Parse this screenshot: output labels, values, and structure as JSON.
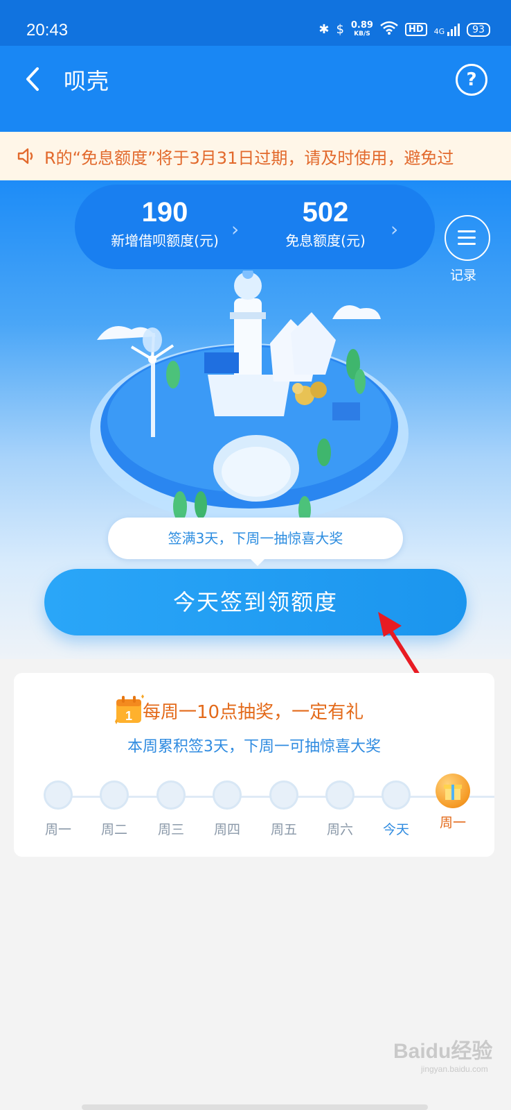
{
  "status_bar": {
    "time": "20:43",
    "network_speed": "0.89",
    "speed_unit": "KB/S",
    "hd": "HD",
    "signal": "4G",
    "battery": "93"
  },
  "app_bar": {
    "title": "呗壳"
  },
  "notice": {
    "text": "R的“免息额度”将于3月31日过期，请及时使用，避免过"
  },
  "stats": [
    {
      "value": "190",
      "label": "新增借呗额度(元)"
    },
    {
      "value": "502",
      "label": "免息额度(元)"
    }
  ],
  "record": {
    "label": "记录"
  },
  "bubble": {
    "text": "签满3天，下周一抽惊喜大奖"
  },
  "sign_button": {
    "label": "今天签到领额度"
  },
  "promo": {
    "icon_number": "1",
    "title": "每周一10点抽奖，一定有礼",
    "subtitle": "本周累积签3天，下周一可抽惊喜大奖"
  },
  "week": [
    {
      "label": "周一"
    },
    {
      "label": "周二"
    },
    {
      "label": "周三"
    },
    {
      "label": "周四"
    },
    {
      "label": "周五"
    },
    {
      "label": "周六"
    },
    {
      "label": "今天"
    },
    {
      "label": "周一"
    }
  ],
  "watermark": {
    "brand": "Baidu经验",
    "url": "jingyan.baidu.com"
  },
  "colors": {
    "primary": "#1987f4",
    "notice_text": "#e2692c",
    "accent_orange": "#e36a1a",
    "link_blue": "#2f8be0"
  }
}
